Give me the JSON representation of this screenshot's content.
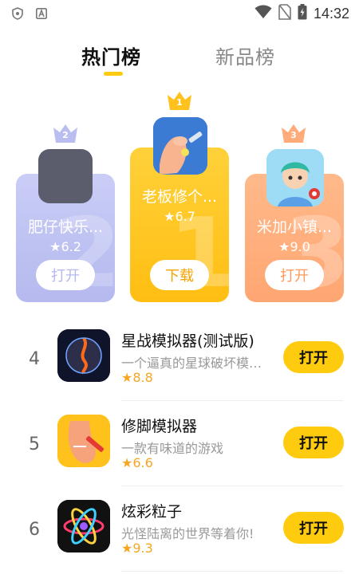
{
  "status_bar": {
    "time": "14:32",
    "left_icons": [
      "shield-icon",
      "app-a-icon"
    ],
    "right_icons": [
      "wifi-icon",
      "no-sim-icon",
      "battery-charging-icon"
    ]
  },
  "tabs": [
    {
      "label": "热门榜",
      "active": true
    },
    {
      "label": "新品榜",
      "active": false
    }
  ],
  "podium": [
    {
      "rank": "2",
      "title": "肥仔快乐...",
      "rating": "6.2",
      "button": "打开",
      "button_color": "#b5b9ee",
      "card_color": "#c5c9f4"
    },
    {
      "rank": "1",
      "title": "老板修个...",
      "rating": "6.7",
      "button": "下载",
      "button_color": "#f5a300",
      "card_color": "#ffc21d"
    },
    {
      "rank": "3",
      "title": "米加小镇...",
      "rating": "9.0",
      "button": "打开",
      "button_color": "#ff9a5c",
      "card_color": "#ffae7e"
    }
  ],
  "list": [
    {
      "rank": "4",
      "title": "星战模拟器(测试版)",
      "description": "一个逼真的星球破坏模拟器",
      "rating": "8.8",
      "button": "打开"
    },
    {
      "rank": "5",
      "title": "修脚模拟器",
      "description": "一款有味道的游戏",
      "rating": "6.6",
      "button": "打开"
    },
    {
      "rank": "6",
      "title": "炫彩粒子",
      "description": "光怪陆离的世界等着你!",
      "rating": "9.3",
      "button": "打开"
    }
  ],
  "colors": {
    "accent": "#ffcb0e",
    "star": "#f5a623"
  }
}
